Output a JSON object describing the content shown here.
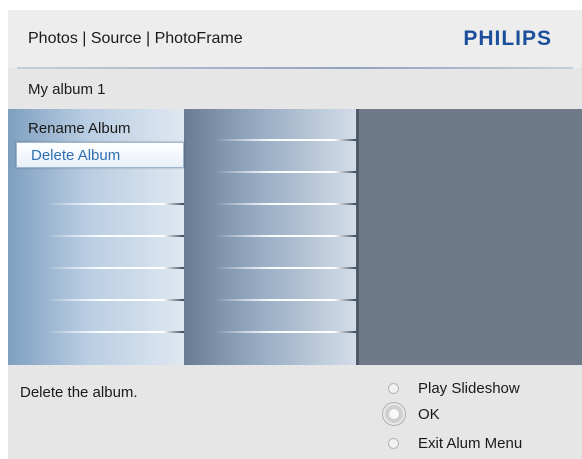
{
  "header": {
    "breadcrumb": "Photos | Source | PhotoFrame",
    "brand": "PHILIPS"
  },
  "album": {
    "title": "My album 1"
  },
  "menu": {
    "items": [
      {
        "label": "Rename Album",
        "selected": false
      },
      {
        "label": "Delete Album",
        "selected": true
      }
    ]
  },
  "footer": {
    "description": "Delete the album.",
    "controls": [
      {
        "label": "Play Slideshow",
        "icon": "button-dot-icon"
      },
      {
        "label": "OK",
        "icon": "ok-knob-icon"
      },
      {
        "label": "Exit Alum Menu",
        "icon": "button-dot-icon"
      }
    ]
  },
  "colors": {
    "brand": "#1b4f9c",
    "selected_text": "#2e6fb4",
    "panel_background": "#6f7a89"
  }
}
